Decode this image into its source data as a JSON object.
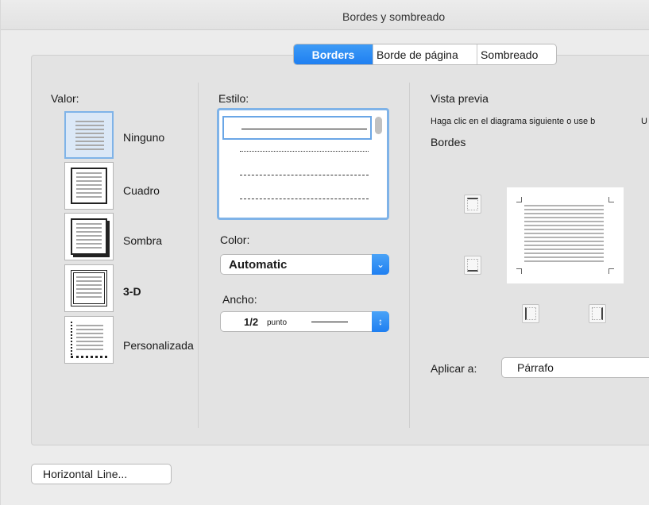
{
  "window": {
    "title": "Bordes y sombreado"
  },
  "tabs": [
    {
      "label": "Borders",
      "active": true
    },
    {
      "label": "Borde de página",
      "active": false
    },
    {
      "label": "Sombreado",
      "active": false
    }
  ],
  "valor": {
    "label": "Valor:",
    "options": [
      {
        "label": "Ninguno",
        "icon": "border-none-icon",
        "selected": true
      },
      {
        "label": "Cuadro",
        "icon": "border-box-icon",
        "selected": false
      },
      {
        "label": "Sombra",
        "icon": "border-shadow-icon",
        "selected": false
      },
      {
        "label": "3-D",
        "icon": "border-3d-icon",
        "selected": false
      },
      {
        "label": "Personalizada",
        "icon": "border-custom-icon",
        "selected": false
      }
    ]
  },
  "estilo": {
    "label": "Estilo:",
    "styles": [
      "solid",
      "dotted",
      "dashed-small",
      "dashed-large"
    ]
  },
  "color": {
    "label": "Color:",
    "value": "Automatic"
  },
  "ancho": {
    "label": "Ancho:",
    "value": "1/2",
    "unit": "punto"
  },
  "preview": {
    "label": "Vista previa",
    "hint": "Haga clic en el diagrama siguiente o use b",
    "hint_end": "U",
    "bordes_label": "Bordes"
  },
  "aplicar": {
    "label": "Aplicar a:",
    "value": "Párrafo"
  },
  "horizontal_line_button": {
    "label_part1": "Horizontal",
    "label_part2": "Line..."
  },
  "colors": {
    "accent": "#1f7ff1",
    "selection": "#7fb3e8"
  }
}
